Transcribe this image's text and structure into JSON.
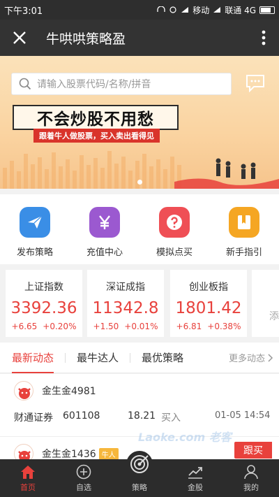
{
  "status_bar": {
    "time": "下午3:01",
    "carrier1": "移动",
    "carrier2": "联通 4G"
  },
  "app_bar": {
    "close_icon": "close-icon",
    "title": "牛哄哄策略盈",
    "more_icon": "more-vertical-icon"
  },
  "banner": {
    "search_placeholder": "请输入股票代码/名称/拼音",
    "slogan": "不会炒股不用愁",
    "subslogan": "跟着牛人做股票，买入卖出看得见",
    "page_indicator": "1 of 1"
  },
  "quick_actions": [
    {
      "label": "发布策略",
      "icon": "paper-plane-icon",
      "color": "#3a8ee6"
    },
    {
      "label": "充值中心",
      "icon": "yen-icon",
      "color": "#9b59d0"
    },
    {
      "label": "模拟点买",
      "icon": "question-icon",
      "color": "#ef4f55"
    },
    {
      "label": "新手指引",
      "icon": "book-icon",
      "color": "#f5a623"
    }
  ],
  "indices": [
    {
      "name": "上证指数",
      "value": "3392.36",
      "change": "+6.65",
      "pct": "+0.20%"
    },
    {
      "name": "深证成指",
      "value": "11342.8",
      "change": "+1.50",
      "pct": "+0.01%"
    },
    {
      "name": "创业板指",
      "value": "1801.42",
      "change": "+6.81",
      "pct": "+0.38%"
    }
  ],
  "indices_add": "添",
  "tabs": {
    "items": [
      "最新动态",
      "最牛达人",
      "最优策略"
    ],
    "active": 0,
    "more": "更多动态"
  },
  "feed": [
    {
      "user": "金生金4981",
      "broker": "财通证券",
      "code": "601108",
      "price": "18.21",
      "action": "买入",
      "time": "01-05 14:54",
      "badge": ""
    },
    {
      "user": "金生金1436",
      "broker": "",
      "code": "",
      "price": "",
      "action": "",
      "time": "",
      "badge": "牛人"
    }
  ],
  "follow_button": "跟买",
  "watermark": "Laoke.com 老客",
  "bottom_nav": [
    {
      "label": "首页",
      "icon": "home-icon",
      "active": true
    },
    {
      "label": "自选",
      "icon": "plus-circle-icon",
      "active": false
    },
    {
      "label": "策略",
      "icon": "target-icon",
      "active": false
    },
    {
      "label": "金股",
      "icon": "trend-chart-icon",
      "active": false
    },
    {
      "label": "我的",
      "icon": "user-icon",
      "active": false
    }
  ],
  "colors": {
    "accent": "#e8413c",
    "dark": "#333333",
    "banner": "#fad3a0"
  }
}
